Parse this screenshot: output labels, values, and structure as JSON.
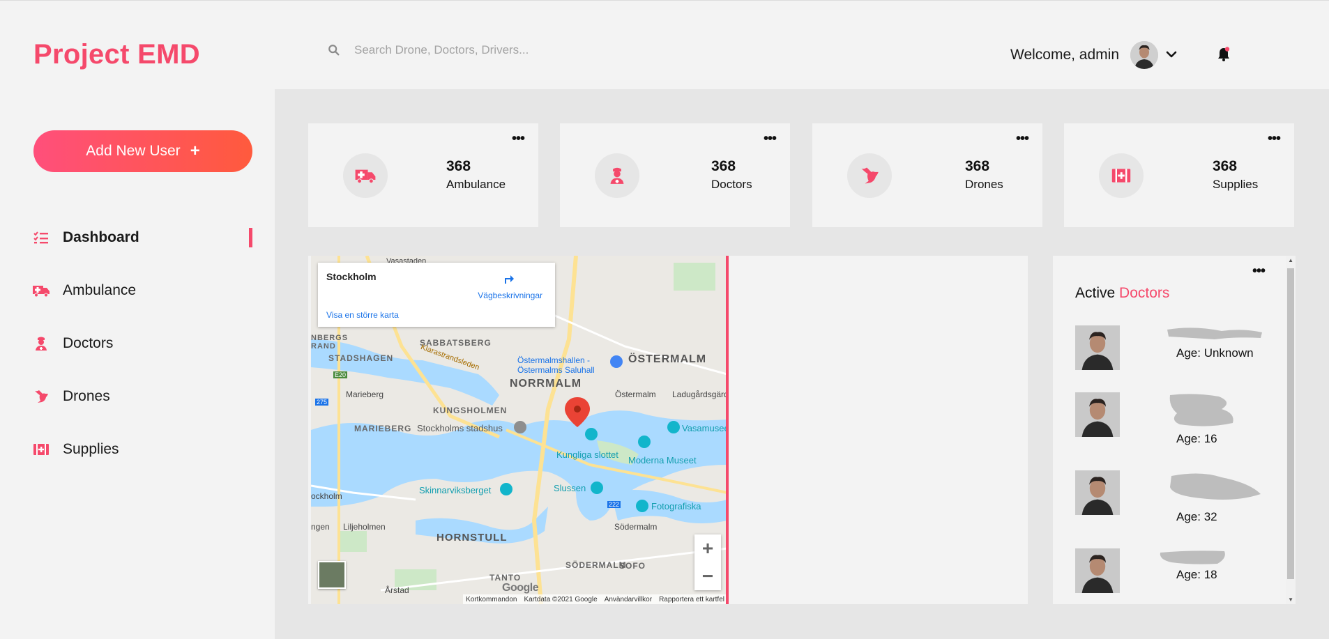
{
  "header": {
    "brand": "Project EMD",
    "search_placeholder": "Search Drone, Doctors, Drivers...",
    "welcome": "Welcome, admin"
  },
  "sidebar": {
    "add_user_label": "Add New User",
    "items": [
      {
        "label": "Dashboard",
        "icon": "list-icon",
        "active": true
      },
      {
        "label": "Ambulance",
        "icon": "ambulance-icon",
        "active": false
      },
      {
        "label": "Doctors",
        "icon": "doctor-icon",
        "active": false
      },
      {
        "label": "Drones",
        "icon": "drone-icon",
        "active": false
      },
      {
        "label": "Supplies",
        "icon": "medkit-icon",
        "active": false
      }
    ]
  },
  "stats": [
    {
      "value": "368",
      "label": "Ambulance",
      "icon": "ambulance-icon"
    },
    {
      "value": "368",
      "label": "Doctors",
      "icon": "doctor-icon"
    },
    {
      "value": "368",
      "label": "Drones",
      "icon": "drone-icon"
    },
    {
      "value": "368",
      "label": "Supplies",
      "icon": "medkit-icon"
    }
  ],
  "map": {
    "place_name": "Stockholm",
    "directions": "Vägbeskrivningar",
    "larger_map": "Visa en större karta",
    "attribution": [
      "Kortkommandon",
      "Kartdata ©2021 Google",
      "Användarvillkor",
      "Rapportera ett kartfel"
    ],
    "logo": "Google",
    "labels": [
      "Vasastaden",
      "SABBATSBERG",
      "STADSHAGEN",
      "Klarastrandsleden",
      "Östermalmshallen - Östermalms Saluhall",
      "ÖSTERMALM",
      "NORRMALM",
      "Marieberg",
      "KUNGSHOLMEN",
      "Östermalm",
      "Ladugårdsgärdet",
      "MARIEBERG",
      "Stockholms stadshus",
      "Vasamuseet",
      "Kungliga slottet",
      "Moderna Museet",
      "Skinnarviksberget",
      "Slussen",
      "Fotografiska",
      "Liljeholmen",
      "HORNSTULL",
      "Södermalm",
      "SÖDERMALM",
      "SOFO",
      "TANTO",
      "Årstad",
      "ockholm",
      "ngen",
      "NBERGS",
      "RAND",
      "E20",
      "275",
      "222"
    ]
  },
  "doctors": {
    "title_prefix": "Active",
    "title_highlight": "Doctors",
    "list": [
      {
        "age": "Age: Unknown"
      },
      {
        "age": "Age: 16"
      },
      {
        "age": "Age: 32"
      },
      {
        "age": "Age: 18"
      }
    ]
  },
  "colors": {
    "accent": "#f5496b",
    "gradient_end": "#ff5a3d"
  }
}
